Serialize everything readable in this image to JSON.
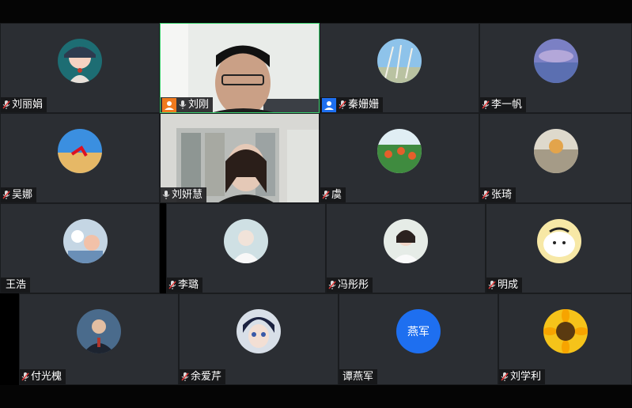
{
  "participants": {
    "row1": [
      {
        "name": "刘丽娟",
        "avatar_icon": "woman-hat-icon"
      },
      {
        "name": "刘刚",
        "host": true,
        "video": true
      },
      {
        "name": "秦姗姗",
        "cohost": true,
        "avatar_icon": "grass-sky-icon"
      },
      {
        "name": "李一帆",
        "avatar_icon": "purple-sky-icon"
      }
    ],
    "row2": [
      {
        "name": "吴娜",
        "avatar_icon": "desert-icon"
      },
      {
        "name": "刘妍慧",
        "video": true
      },
      {
        "name": "虞",
        "avatar_icon": "flowers-icon"
      },
      {
        "name": "张琦",
        "avatar_icon": "cat-icon"
      }
    ],
    "row3": [
      {
        "name": "王浩",
        "avatar_icon": "cartoon-group-icon"
      },
      {
        "name": "李璐",
        "avatar_icon": "girl-white-icon"
      },
      {
        "name": "冯彤彤",
        "avatar_icon": "girl-portrait-icon"
      },
      {
        "name": "明成",
        "avatar_icon": "cartoon-cat-icon"
      }
    ],
    "row4": [
      {
        "name": "付光槐",
        "avatar_icon": "man-suit-icon"
      },
      {
        "name": "余爱芹",
        "avatar_icon": "anime-boy-icon"
      },
      {
        "name": "谭燕军",
        "avatar_text": "燕军",
        "muted_icon": false
      },
      {
        "name": "刘学利",
        "avatar_icon": "sunflower-icon"
      }
    ]
  },
  "colors": {
    "tile_bg": "#2b2e33",
    "active_border": "#3bd16f",
    "host_badge": "#f07a1e",
    "cohost_badge": "#1e6ff0",
    "mic_muted": "#e23b3b"
  }
}
